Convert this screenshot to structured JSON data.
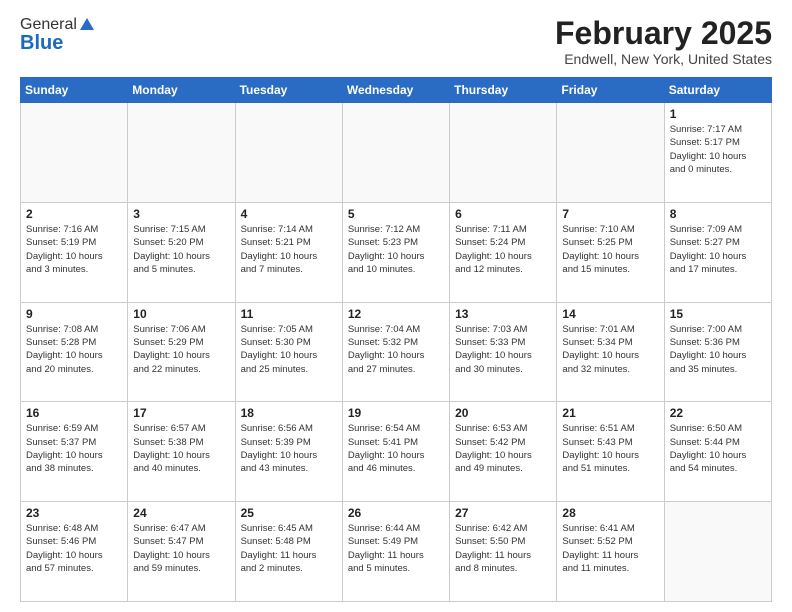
{
  "header": {
    "logo_general": "General",
    "logo_blue": "Blue",
    "month_title": "February 2025",
    "subtitle": "Endwell, New York, United States"
  },
  "weekdays": [
    "Sunday",
    "Monday",
    "Tuesday",
    "Wednesday",
    "Thursday",
    "Friday",
    "Saturday"
  ],
  "weeks": [
    [
      {
        "day": "",
        "info": ""
      },
      {
        "day": "",
        "info": ""
      },
      {
        "day": "",
        "info": ""
      },
      {
        "day": "",
        "info": ""
      },
      {
        "day": "",
        "info": ""
      },
      {
        "day": "",
        "info": ""
      },
      {
        "day": "1",
        "info": "Sunrise: 7:17 AM\nSunset: 5:17 PM\nDaylight: 10 hours\nand 0 minutes."
      }
    ],
    [
      {
        "day": "2",
        "info": "Sunrise: 7:16 AM\nSunset: 5:19 PM\nDaylight: 10 hours\nand 3 minutes."
      },
      {
        "day": "3",
        "info": "Sunrise: 7:15 AM\nSunset: 5:20 PM\nDaylight: 10 hours\nand 5 minutes."
      },
      {
        "day": "4",
        "info": "Sunrise: 7:14 AM\nSunset: 5:21 PM\nDaylight: 10 hours\nand 7 minutes."
      },
      {
        "day": "5",
        "info": "Sunrise: 7:12 AM\nSunset: 5:23 PM\nDaylight: 10 hours\nand 10 minutes."
      },
      {
        "day": "6",
        "info": "Sunrise: 7:11 AM\nSunset: 5:24 PM\nDaylight: 10 hours\nand 12 minutes."
      },
      {
        "day": "7",
        "info": "Sunrise: 7:10 AM\nSunset: 5:25 PM\nDaylight: 10 hours\nand 15 minutes."
      },
      {
        "day": "8",
        "info": "Sunrise: 7:09 AM\nSunset: 5:27 PM\nDaylight: 10 hours\nand 17 minutes."
      }
    ],
    [
      {
        "day": "9",
        "info": "Sunrise: 7:08 AM\nSunset: 5:28 PM\nDaylight: 10 hours\nand 20 minutes."
      },
      {
        "day": "10",
        "info": "Sunrise: 7:06 AM\nSunset: 5:29 PM\nDaylight: 10 hours\nand 22 minutes."
      },
      {
        "day": "11",
        "info": "Sunrise: 7:05 AM\nSunset: 5:30 PM\nDaylight: 10 hours\nand 25 minutes."
      },
      {
        "day": "12",
        "info": "Sunrise: 7:04 AM\nSunset: 5:32 PM\nDaylight: 10 hours\nand 27 minutes."
      },
      {
        "day": "13",
        "info": "Sunrise: 7:03 AM\nSunset: 5:33 PM\nDaylight: 10 hours\nand 30 minutes."
      },
      {
        "day": "14",
        "info": "Sunrise: 7:01 AM\nSunset: 5:34 PM\nDaylight: 10 hours\nand 32 minutes."
      },
      {
        "day": "15",
        "info": "Sunrise: 7:00 AM\nSunset: 5:36 PM\nDaylight: 10 hours\nand 35 minutes."
      }
    ],
    [
      {
        "day": "16",
        "info": "Sunrise: 6:59 AM\nSunset: 5:37 PM\nDaylight: 10 hours\nand 38 minutes."
      },
      {
        "day": "17",
        "info": "Sunrise: 6:57 AM\nSunset: 5:38 PM\nDaylight: 10 hours\nand 40 minutes."
      },
      {
        "day": "18",
        "info": "Sunrise: 6:56 AM\nSunset: 5:39 PM\nDaylight: 10 hours\nand 43 minutes."
      },
      {
        "day": "19",
        "info": "Sunrise: 6:54 AM\nSunset: 5:41 PM\nDaylight: 10 hours\nand 46 minutes."
      },
      {
        "day": "20",
        "info": "Sunrise: 6:53 AM\nSunset: 5:42 PM\nDaylight: 10 hours\nand 49 minutes."
      },
      {
        "day": "21",
        "info": "Sunrise: 6:51 AM\nSunset: 5:43 PM\nDaylight: 10 hours\nand 51 minutes."
      },
      {
        "day": "22",
        "info": "Sunrise: 6:50 AM\nSunset: 5:44 PM\nDaylight: 10 hours\nand 54 minutes."
      }
    ],
    [
      {
        "day": "23",
        "info": "Sunrise: 6:48 AM\nSunset: 5:46 PM\nDaylight: 10 hours\nand 57 minutes."
      },
      {
        "day": "24",
        "info": "Sunrise: 6:47 AM\nSunset: 5:47 PM\nDaylight: 10 hours\nand 59 minutes."
      },
      {
        "day": "25",
        "info": "Sunrise: 6:45 AM\nSunset: 5:48 PM\nDaylight: 11 hours\nand 2 minutes."
      },
      {
        "day": "26",
        "info": "Sunrise: 6:44 AM\nSunset: 5:49 PM\nDaylight: 11 hours\nand 5 minutes."
      },
      {
        "day": "27",
        "info": "Sunrise: 6:42 AM\nSunset: 5:50 PM\nDaylight: 11 hours\nand 8 minutes."
      },
      {
        "day": "28",
        "info": "Sunrise: 6:41 AM\nSunset: 5:52 PM\nDaylight: 11 hours\nand 11 minutes."
      },
      {
        "day": "",
        "info": ""
      }
    ]
  ]
}
